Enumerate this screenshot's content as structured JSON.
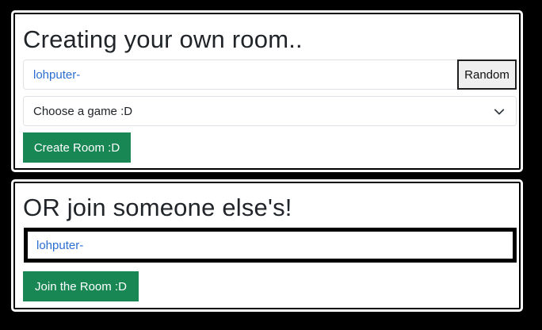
{
  "create": {
    "title": "Creating your own room..",
    "room_name_value": "lohputer-",
    "random_label": "Random",
    "game_select_value": "Choose a game :D",
    "create_button_label": "Create Room :D"
  },
  "join": {
    "title": "OR join someone else's!",
    "room_name_value": "lohputer-",
    "join_button_label": "Join the Room :D"
  },
  "colors": {
    "page_background": "#000000",
    "panel_background": "#ffffff",
    "button_green": "#198754",
    "input_text_blue": "#2a6ed2"
  },
  "icons": {
    "select_arrow": "chevron-down-icon"
  }
}
